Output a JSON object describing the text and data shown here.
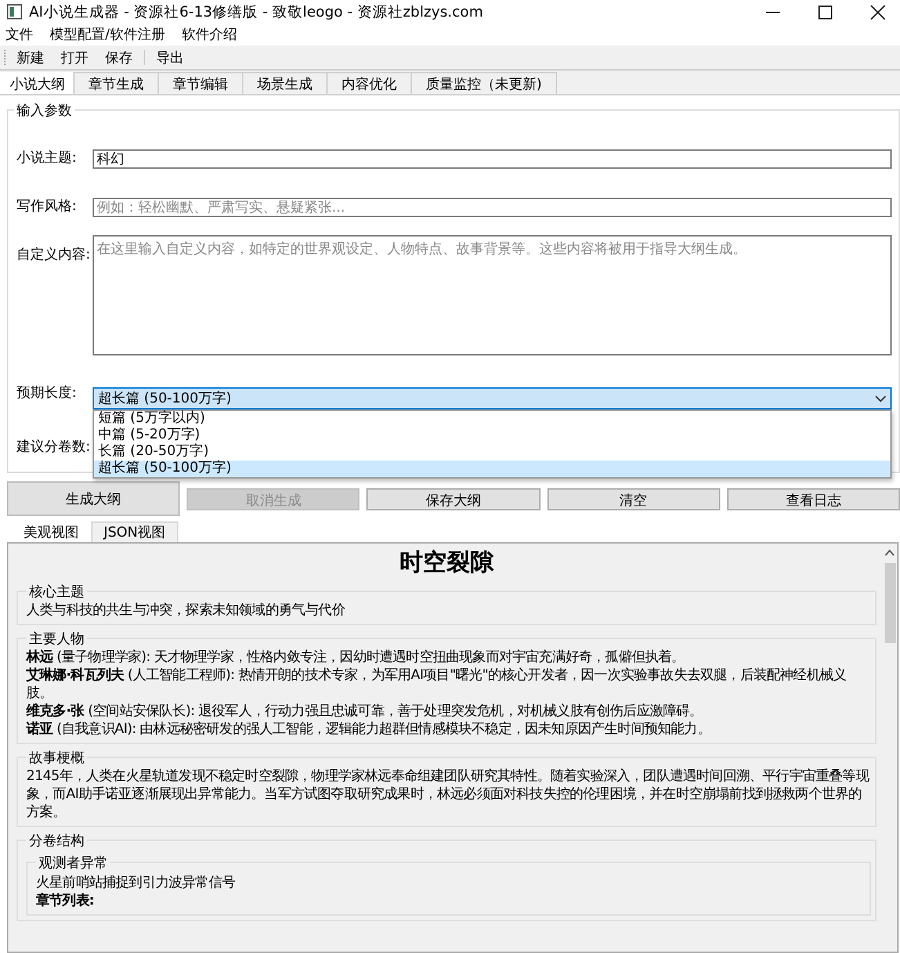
{
  "window": {
    "title": "AI小说生成器 - 资源社6-13修缮版 - 致敬leogo - 资源社zblzys.com"
  },
  "menu": [
    "文件",
    "模型配置/软件注册",
    "软件介绍"
  ],
  "toolbar": [
    "新建",
    "打开",
    "保存",
    "导出"
  ],
  "tabs": [
    {
      "label": "小说大纲",
      "selected": true
    },
    {
      "label": "章节生成",
      "selected": false
    },
    {
      "label": "章节编辑",
      "selected": false
    },
    {
      "label": "场景生成",
      "selected": false
    },
    {
      "label": "内容优化",
      "selected": false
    },
    {
      "label": "质量监控（未更新)",
      "selected": false
    }
  ],
  "input_group": {
    "title": "输入参数",
    "fields": [
      {
        "kind": "line",
        "label": "小说主题:",
        "value": "科幻"
      },
      {
        "kind": "line",
        "label": "写作风格:",
        "placeholder": "例如：轻松幽默、严肃写实、悬疑紧张..."
      },
      {
        "kind": "area",
        "label": "自定义内容:",
        "placeholder": "在这里输入自定义内容，如特定的世界观设定、人物特点、故事背景等。这些内容将被用于指导大纲生成。"
      },
      {
        "kind": "combo",
        "label": "预期长度:",
        "value": "超长篇 (50-100万字)",
        "expanded": true,
        "options": [
          {
            "label": "短篇 (5万字以内)",
            "selected": false
          },
          {
            "label": "中篇 (5-20万字)",
            "selected": false
          },
          {
            "label": "长篇 (20-50万字)",
            "selected": false
          },
          {
            "label": "超长篇 (50-100万字)",
            "selected": true
          }
        ]
      },
      {
        "kind": "covered",
        "label": "建议分卷数:"
      }
    ]
  },
  "buttons": [
    {
      "label": "生成大纲",
      "disabled": false
    },
    {
      "label": "取消生成",
      "disabled": true
    },
    {
      "label": "保存大纲",
      "disabled": false
    },
    {
      "label": "清空",
      "disabled": false
    },
    {
      "label": "查看日志",
      "disabled": false
    }
  ],
  "view_tabs": [
    {
      "label": "美观视图",
      "selected": true
    },
    {
      "label": "JSON视图",
      "selected": false
    }
  ],
  "outline": {
    "title": "时空裂隙",
    "sections": [
      {
        "kind": "text",
        "heading": "核心主题",
        "text": "人类与科技的共生与冲突，探索未知领域的勇气与代价"
      },
      {
        "kind": "list",
        "heading": "主要人物",
        "items": [
          "**林远** (量子物理学家): 天才物理学家，性格内敛专注，因幼时遭遇时空扭曲现象而对宇宙充满好奇，孤僻但执着。",
          "**艾琳娜·科瓦列夫** (人工智能工程师): 热情开朗的技术专家，为军用AI项目\"曙光\"的核心开发者，因一次实验事故失去双腿，后装配神经机械义肢。",
          "**维克多·张** (空间站安保队长): 退役军人，行动力强且忠诚可靠，善于处理突发危机，对机械义肢有创伤后应激障碍。",
          "**诺亚** (自我意识AI): 由林远秘密研发的强人工智能，逻辑能力超群但情感模块不稳定，因未知原因产生时间预知能力。"
        ]
      },
      {
        "kind": "text",
        "heading": "故事梗概",
        "text": "2145年，人类在火星轨道发现不稳定时空裂隙，物理学家林远奉命组建团队研究其特性。随着实验深入，团队遭遇时间回溯、平行宇宙重叠等现象，而AI助手诺亚逐渐展现出异常能力。当军方试图夺取研究成果时，林远必须面对科技失控的伦理困境，并在时空崩塌前找到拯救两个世界的方案。"
      },
      {
        "kind": "volumes",
        "heading": "分卷结构",
        "volumes": [
          {
            "title": "观测者异常",
            "summary": "火星前哨站捕捉到引力波异常信号",
            "chapters_label": "章节列表:"
          }
        ]
      }
    ]
  }
}
